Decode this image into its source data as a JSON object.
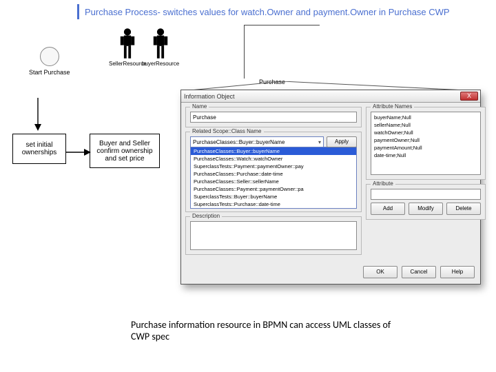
{
  "header": {
    "title": "Purchase Process- switches values for watch.Owner and payment.Owner in Purchase CWP"
  },
  "bpmn": {
    "actors": [
      {
        "label": "SellerResource"
      },
      {
        "label": "buyerResource"
      }
    ],
    "start_label": "Start Purchase",
    "pool_label": "Purchase",
    "tasks": [
      {
        "text": "set initial ownerships"
      },
      {
        "text": "Buyer and Seller confirm ownership and set price"
      }
    ]
  },
  "dialog": {
    "title": "Information Object",
    "close": "X",
    "name_group": "Name",
    "name_value": "Purchase",
    "scope_group": "Related Scope::Class Name",
    "scope_selected": "PurchaseClasses::Buyer::buyerName",
    "apply_btn": "Apply",
    "scope_options": [
      "PurchaseClasses::Buyer::buyerName",
      "PurchaseClasses::Watch::watchOwner",
      "SuperclassTests::Payment::paymentOwner::pay",
      "PurchaseClasses::Purchase::date-time",
      "PurchaseClasses::Seller::sellerName",
      "PurchaseClasses::Payment::paymentOwner::pa",
      "SuperclassTests::Buyer::buyerName",
      "SuperclassTests::Purchase::date-time"
    ],
    "desc_group": "Description",
    "attr_group": "Attribute Names",
    "attributes": [
      "buyerName;Null",
      "sellerName;Null",
      "watchOwner;Null",
      "paymentOwner;Null",
      "paymentAmount;Null",
      "date-time;Null"
    ],
    "attr_single_group": "Attribute",
    "buttons": {
      "add": "Add",
      "modify": "Modify",
      "delete": "Delete",
      "ok": "OK",
      "cancel": "Cancel",
      "help": "Help"
    }
  },
  "caption": "Purchase information resource in BPMN can access UML classes of CWP spec"
}
